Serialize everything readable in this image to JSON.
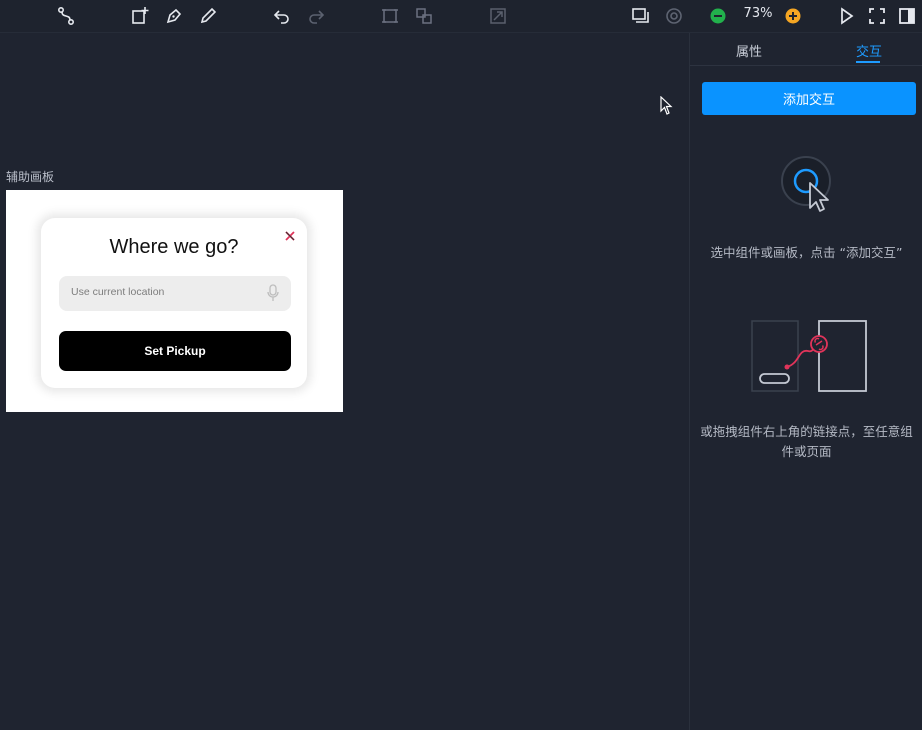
{
  "toolbar": {
    "zoom_text": "73%",
    "icons": [
      "connector-icon",
      "add-page-icon",
      "pen-icon",
      "pencil-icon",
      "undo-icon",
      "redo-icon",
      "frame-icon",
      "group-icon",
      "crop-icon",
      "layers-icon",
      "settings-icon",
      "zoom-out-icon",
      "zoom-in-icon",
      "play-icon",
      "fullscreen-icon",
      "panel-toggle-icon"
    ]
  },
  "canvas": {
    "board_label": "辅助画板",
    "card": {
      "title": "Where we go?",
      "search_placeholder": "Use current location",
      "button_label": "Set Pickup"
    }
  },
  "panel": {
    "tab_properties": "属性",
    "tab_interaction": "交互",
    "add_button": "添加交互",
    "hint1": "选中组件或画板，点击 “添加交互”",
    "hint2": "或拖拽组件右上角的链接点，至任意组件或页面"
  },
  "colors": {
    "accent": "#0a93ff",
    "zoom_out": "#22b14c",
    "zoom_in": "#f5a623",
    "background": "#1f2430"
  }
}
